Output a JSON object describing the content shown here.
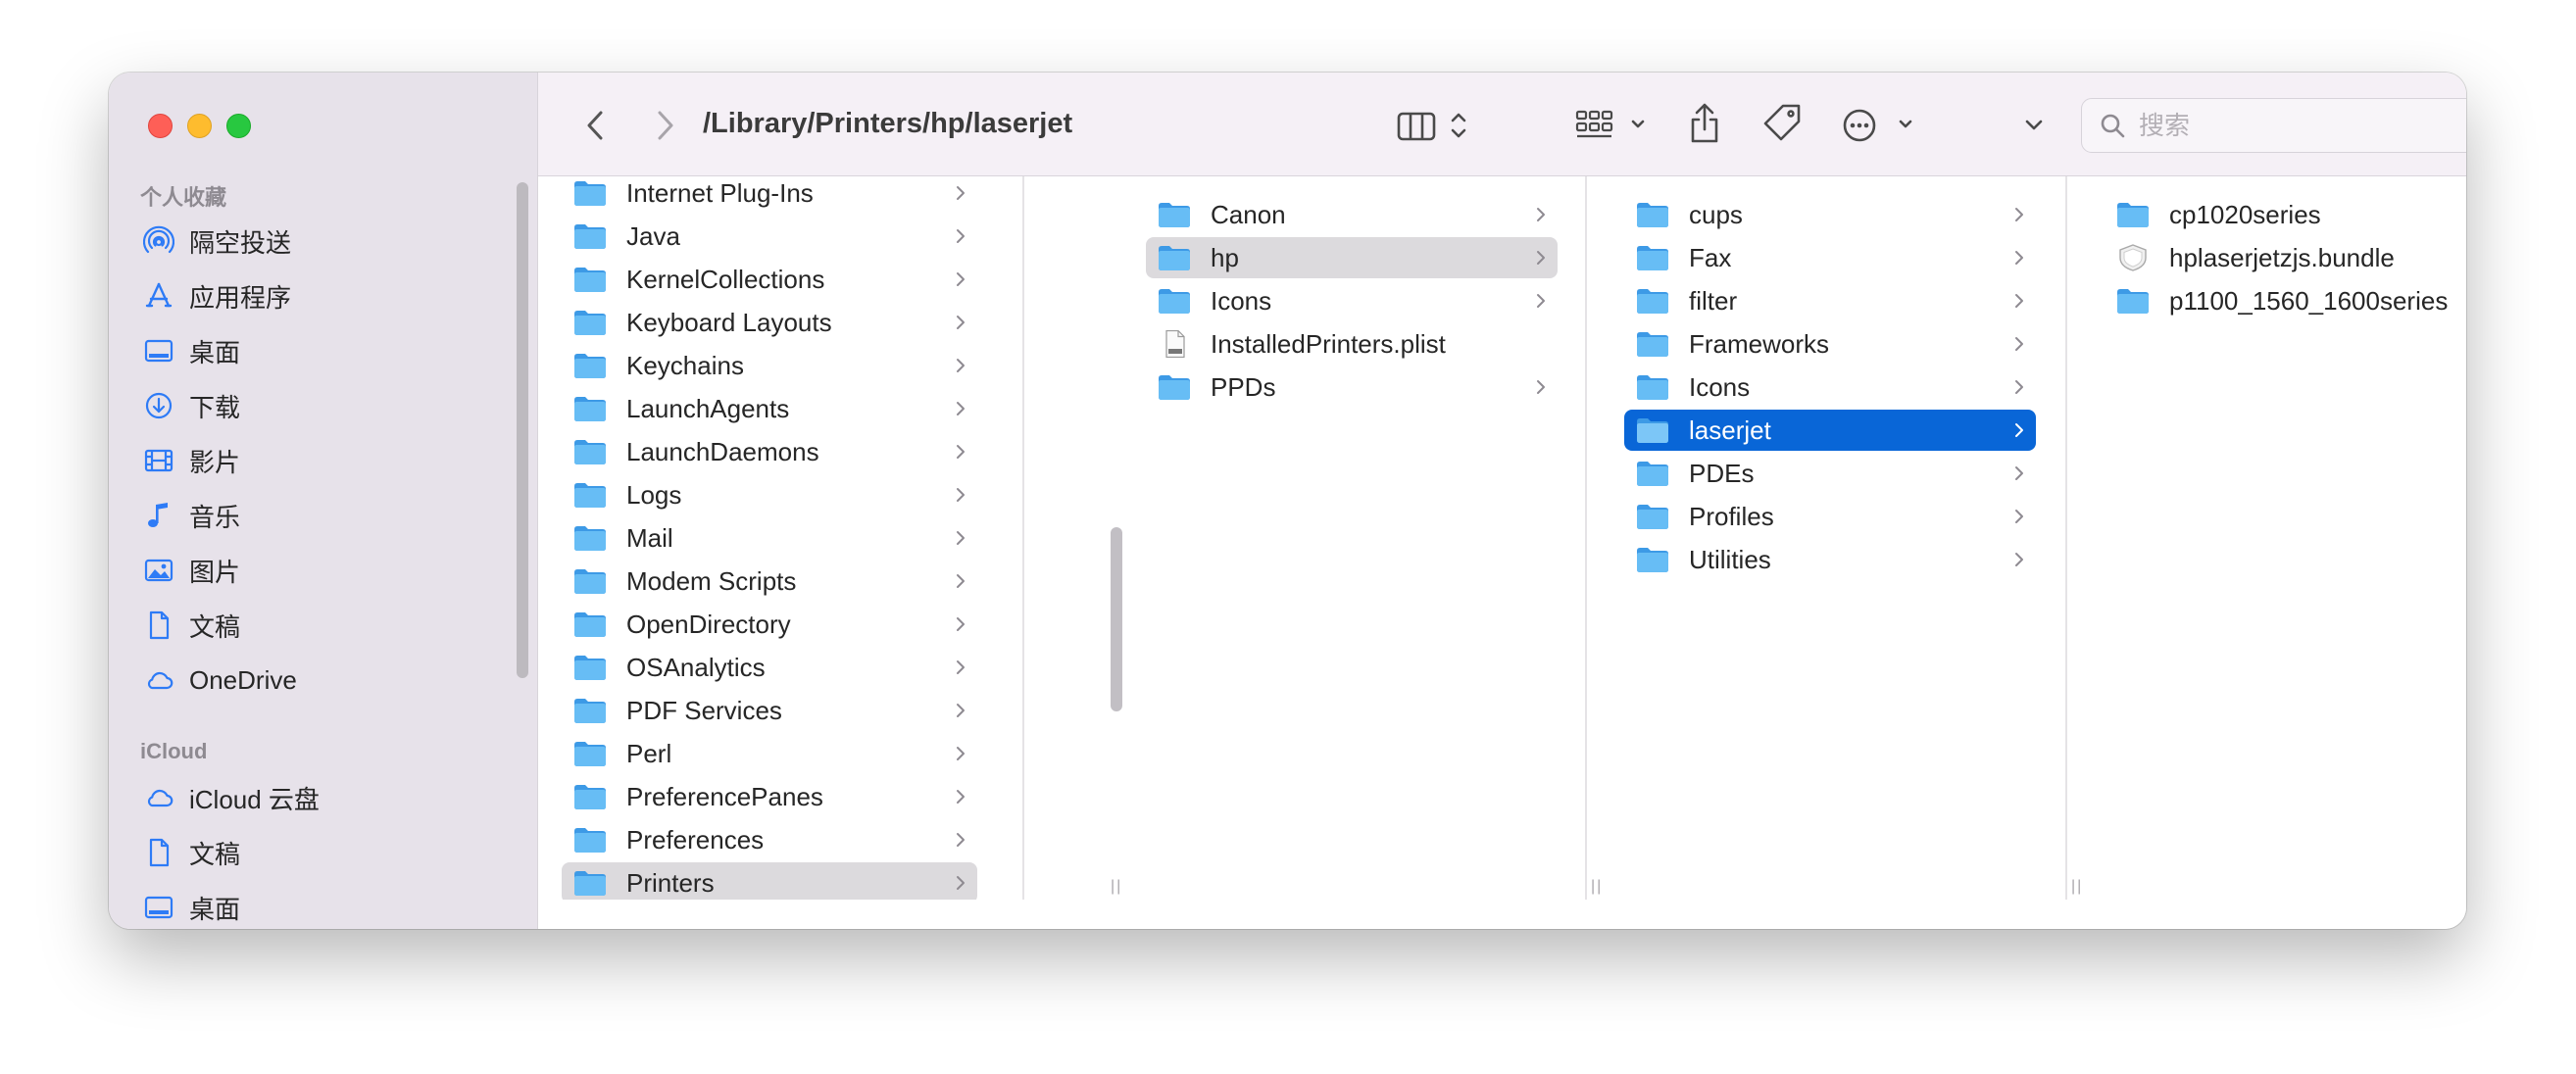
{
  "window": {
    "path_title": "/Library/Printers/hp/laserjet",
    "search_placeholder": "搜索"
  },
  "sidebar": {
    "favorites_heading": "个人收藏",
    "favorites": [
      {
        "label": "隔空投送",
        "icon": "airdrop-icon"
      },
      {
        "label": "应用程序",
        "icon": "applications-icon"
      },
      {
        "label": "桌面",
        "icon": "desktop-icon"
      },
      {
        "label": "下载",
        "icon": "downloads-icon"
      },
      {
        "label": "影片",
        "icon": "movies-icon"
      },
      {
        "label": "音乐",
        "icon": "music-icon"
      },
      {
        "label": "图片",
        "icon": "pictures-icon"
      },
      {
        "label": "文稿",
        "icon": "documents-icon"
      },
      {
        "label": "OneDrive",
        "icon": "cloud-icon"
      }
    ],
    "icloud_heading": "iCloud",
    "icloud": [
      {
        "label": "iCloud 云盘",
        "icon": "cloud-icon"
      },
      {
        "label": "文稿",
        "icon": "documents-icon"
      },
      {
        "label": "桌面",
        "icon": "desktop-icon"
      }
    ]
  },
  "columns": [
    {
      "items": [
        {
          "label": "Internet Plug-Ins",
          "type": "folder"
        },
        {
          "label": "Java",
          "type": "folder"
        },
        {
          "label": "KernelCollections",
          "type": "folder"
        },
        {
          "label": "Keyboard Layouts",
          "type": "folder"
        },
        {
          "label": "Keychains",
          "type": "folder"
        },
        {
          "label": "LaunchAgents",
          "type": "folder"
        },
        {
          "label": "LaunchDaemons",
          "type": "folder"
        },
        {
          "label": "Logs",
          "type": "folder"
        },
        {
          "label": "Mail",
          "type": "folder"
        },
        {
          "label": "Modem Scripts",
          "type": "folder"
        },
        {
          "label": "OpenDirectory",
          "type": "folder"
        },
        {
          "label": "OSAnalytics",
          "type": "folder"
        },
        {
          "label": "PDF Services",
          "type": "folder"
        },
        {
          "label": "Perl",
          "type": "folder"
        },
        {
          "label": "PreferencePanes",
          "type": "folder"
        },
        {
          "label": "Preferences",
          "type": "folder"
        },
        {
          "label": "Printers",
          "type": "folder",
          "selected": "gray"
        }
      ]
    },
    {
      "items": [
        {
          "label": "Canon",
          "type": "folder"
        },
        {
          "label": "hp",
          "type": "folder",
          "selected": "gray"
        },
        {
          "label": "Icons",
          "type": "folder"
        },
        {
          "label": "InstalledPrinters.plist",
          "type": "plist"
        },
        {
          "label": "PPDs",
          "type": "folder"
        }
      ]
    },
    {
      "items": [
        {
          "label": "cups",
          "type": "folder"
        },
        {
          "label": "Fax",
          "type": "folder"
        },
        {
          "label": "filter",
          "type": "folder"
        },
        {
          "label": "Frameworks",
          "type": "folder"
        },
        {
          "label": "Icons",
          "type": "folder"
        },
        {
          "label": "laserjet",
          "type": "folder",
          "selected": "blue"
        },
        {
          "label": "PDEs",
          "type": "folder"
        },
        {
          "label": "Profiles",
          "type": "folder"
        },
        {
          "label": "Utilities",
          "type": "folder"
        }
      ]
    },
    {
      "items": [
        {
          "label": "cp1020series",
          "type": "folder"
        },
        {
          "label": "hplaserjetzjs.bundle",
          "type": "bundle"
        },
        {
          "label": "p1100_1560_1600series",
          "type": "folder"
        }
      ]
    }
  ],
  "colors": {
    "accent": "#0966d7",
    "folder": "#5ab4f0",
    "sidebar_icon": "#2e7bf6"
  }
}
